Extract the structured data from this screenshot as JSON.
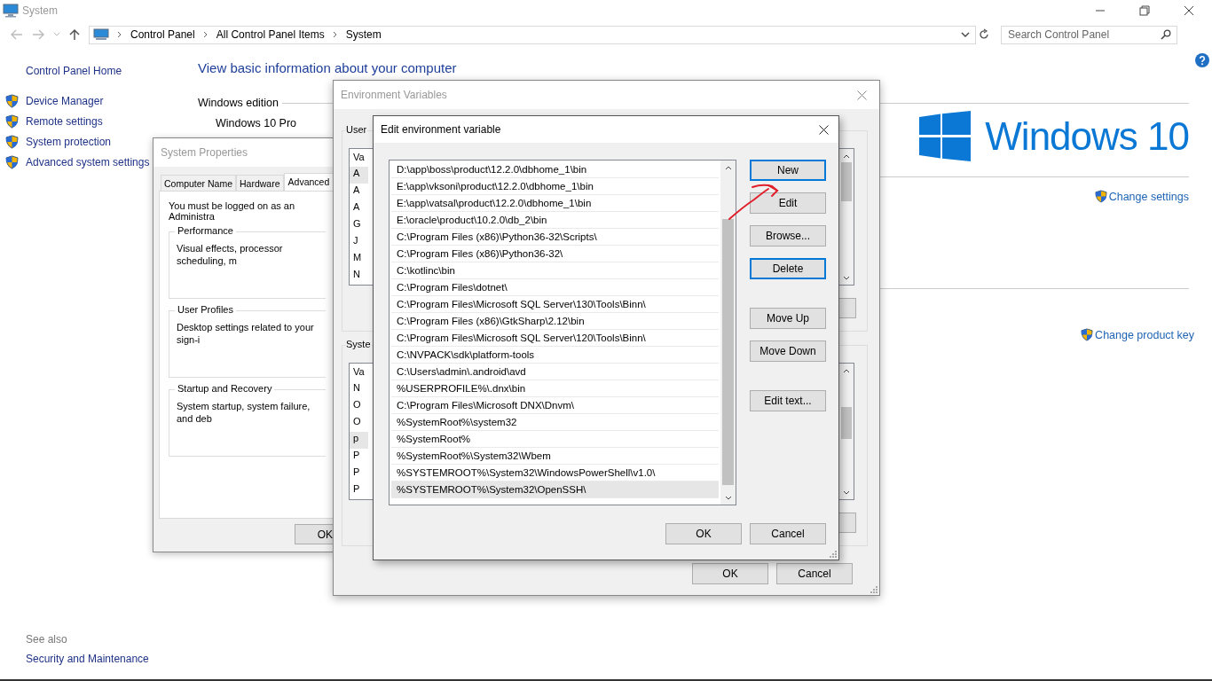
{
  "window": {
    "title": "System"
  },
  "address_bar": {
    "breadcrumbs": [
      "Control Panel",
      "All Control Panel Items",
      "System"
    ]
  },
  "search": {
    "placeholder": "Search Control Panel"
  },
  "sidebar": {
    "home": "Control Panel Home",
    "items": [
      "Device Manager",
      "Remote settings",
      "System protection",
      "Advanced system settings"
    ],
    "see_also": "See also",
    "see_also_items": [
      "Security and Maintenance"
    ]
  },
  "main": {
    "heading": "View basic information about your computer",
    "edition_heading": "Windows edition",
    "edition": "Windows 10 Pro",
    "logo": "Windows 10",
    "links": [
      "Change settings",
      "Change product key"
    ]
  },
  "system_properties": {
    "title": "System Properties",
    "tabs": [
      {
        "label": "Computer Name",
        "selected": false
      },
      {
        "label": "Hardware",
        "selected": false
      },
      {
        "label": "Advanced",
        "selected": true
      }
    ],
    "notice": "You must be logged on as an Administra",
    "groups": [
      {
        "title": "Performance",
        "text": "Visual effects, processor scheduling, m"
      },
      {
        "title": "User Profiles",
        "text": "Desktop settings related to your sign-i"
      },
      {
        "title": "Startup and Recovery",
        "text": "System startup, system failure, and deb"
      }
    ],
    "buttons": [
      "OK"
    ]
  },
  "environment_variables": {
    "title": "Environment Variables",
    "user_group": "User",
    "user_header": "Va",
    "user_rows": [
      {
        "text": "A",
        "selected": true
      },
      {
        "text": "A",
        "selected": false
      },
      {
        "text": "A",
        "selected": false
      },
      {
        "text": "G",
        "selected": false
      },
      {
        "text": "J",
        "selected": false
      },
      {
        "text": "M",
        "selected": false
      },
      {
        "text": "N",
        "selected": false
      }
    ],
    "system_group": "Syste",
    "system_header": "Va",
    "system_rows": [
      {
        "text": "N",
        "selected": false
      },
      {
        "text": "O",
        "selected": false
      },
      {
        "text": "O",
        "selected": false
      },
      {
        "text": "p",
        "selected": true
      },
      {
        "text": "P",
        "selected": false
      },
      {
        "text": "P",
        "selected": false
      },
      {
        "text": "P",
        "selected": false
      }
    ],
    "buttons": [
      "OK",
      "Cancel"
    ]
  },
  "edit_dialog": {
    "title": "Edit environment variable",
    "entries": [
      {
        "text": "D:\\app\\boss\\product\\12.2.0\\dbhome_1\\bin",
        "selected": false
      },
      {
        "text": "E:\\app\\vksoni\\product\\12.2.0\\dbhome_1\\bin",
        "selected": false
      },
      {
        "text": "E:\\app\\vatsal\\product\\12.2.0\\dbhome_1\\bin",
        "selected": false
      },
      {
        "text": "E:\\oracle\\product\\10.2.0\\db_2\\bin",
        "selected": false
      },
      {
        "text": "C:\\Program Files (x86)\\Python36-32\\Scripts\\",
        "selected": false
      },
      {
        "text": "C:\\Program Files (x86)\\Python36-32\\",
        "selected": false
      },
      {
        "text": "C:\\kotlinc\\bin",
        "selected": false
      },
      {
        "text": "C:\\Program Files\\dotnet\\",
        "selected": false
      },
      {
        "text": "C:\\Program Files\\Microsoft SQL Server\\130\\Tools\\Binn\\",
        "selected": false
      },
      {
        "text": "C:\\Program Files (x86)\\GtkSharp\\2.12\\bin",
        "selected": false
      },
      {
        "text": "C:\\Program Files\\Microsoft SQL Server\\120\\Tools\\Binn\\",
        "selected": false
      },
      {
        "text": "C:\\NVPACK\\sdk\\platform-tools",
        "selected": false
      },
      {
        "text": "C:\\Users\\admin\\.android\\avd",
        "selected": false
      },
      {
        "text": "%USERPROFILE%\\.dnx\\bin",
        "selected": false
      },
      {
        "text": "C:\\Program Files\\Microsoft DNX\\Dnvm\\",
        "selected": false
      },
      {
        "text": "%SystemRoot%\\system32",
        "selected": false
      },
      {
        "text": "%SystemRoot%",
        "selected": false
      },
      {
        "text": "%SystemRoot%\\System32\\Wbem",
        "selected": false
      },
      {
        "text": "%SYSTEMROOT%\\System32\\WindowsPowerShell\\v1.0\\",
        "selected": false
      },
      {
        "text": "%SYSTEMROOT%\\System32\\OpenSSH\\",
        "selected": true
      }
    ],
    "side_buttons": [
      [
        {
          "label": "New",
          "focused": true
        },
        {
          "label": "Edit",
          "focused": false
        },
        {
          "label": "Browse...",
          "focused": false
        },
        {
          "label": "Delete",
          "focused": true
        }
      ],
      [
        {
          "label": "Move Up",
          "focused": false
        },
        {
          "label": "Move Down",
          "focused": false
        }
      ],
      [
        {
          "label": "Edit text...",
          "focused": false
        }
      ]
    ],
    "buttons": [
      "OK",
      "Cancel"
    ]
  }
}
